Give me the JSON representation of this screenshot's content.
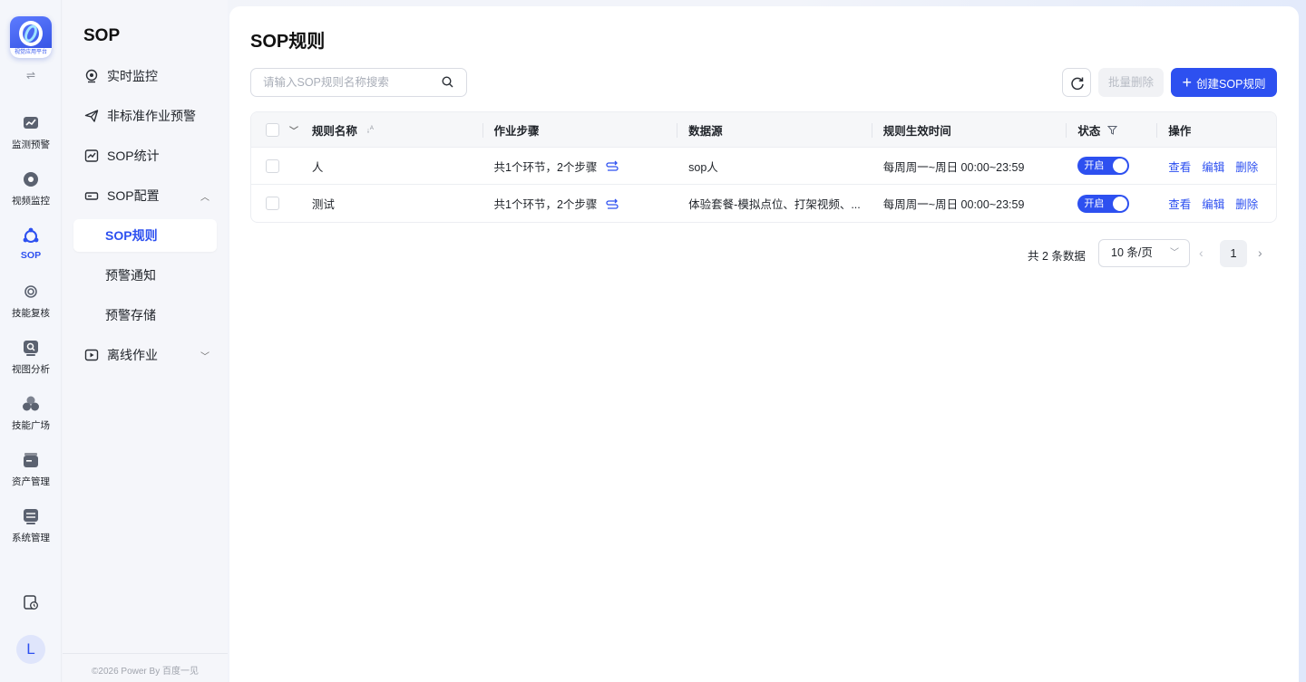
{
  "app": {
    "logo_caption": "视觉应用平台",
    "collapse_icon": "⇌"
  },
  "rail": {
    "items": [
      {
        "label": "监测预警",
        "icon": "monitor-chart-icon"
      },
      {
        "label": "视频监控",
        "icon": "camera-icon"
      },
      {
        "label": "SOP",
        "icon": "sop-icon"
      },
      {
        "label": "技能复核",
        "icon": "target-icon"
      },
      {
        "label": "视图分析",
        "icon": "view-analysis-icon"
      },
      {
        "label": "技能广场",
        "icon": "skills-icon"
      },
      {
        "label": "资产管理",
        "icon": "asset-icon"
      },
      {
        "label": "系统管理",
        "icon": "settings-icon"
      }
    ],
    "active": "SOP",
    "avatar_letter": "L"
  },
  "menu": {
    "title": "SOP",
    "items": [
      {
        "label": "实时监控",
        "icon": "camera-outline-icon"
      },
      {
        "label": "非标准作业预警",
        "icon": "send-icon"
      },
      {
        "label": "SOP统计",
        "icon": "stats-icon"
      },
      {
        "label": "SOP配置",
        "icon": "config-icon"
      },
      {
        "label": "SOP规则"
      },
      {
        "label": "预警通知"
      },
      {
        "label": "预警存储"
      },
      {
        "label": "离线作业",
        "icon": "video-icon"
      }
    ],
    "footer": "©2026 Power By 百度一见"
  },
  "page": {
    "title": "SOP规则",
    "search_placeholder": "请输入SOP规则名称搜索",
    "bulk_delete": "批量删除",
    "create": "创建SOP规则"
  },
  "table": {
    "headers": [
      "规则名称",
      "作业步骤",
      "数据源",
      "规则生效时间",
      "状态",
      "操作"
    ],
    "rows": [
      {
        "name": "人",
        "steps": "共1个环节，2个步骤",
        "source": "sop人",
        "time": "每周周一~周日 00:00~23:59",
        "status": "开启"
      },
      {
        "name": "测试",
        "steps": "共1个环节，2个步骤",
        "source": "体验套餐-模拟点位、打架视频、...",
        "time": "每周周一~周日 00:00~23:59",
        "status": "开启"
      }
    ],
    "actions": [
      "查看",
      "编辑",
      "删除"
    ]
  },
  "pagination": {
    "total": "共 2 条数据",
    "page_size": "10 条/页",
    "current": "1"
  },
  "colors": {
    "primary": "#2d50f0",
    "text": "#1f2329"
  }
}
